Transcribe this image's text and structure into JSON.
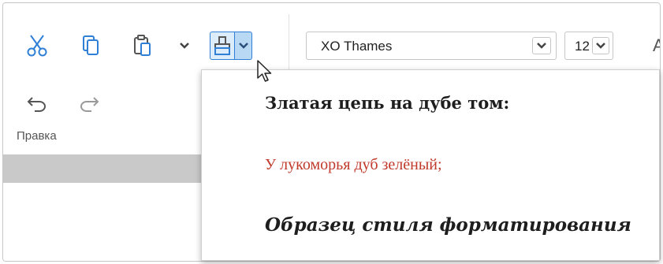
{
  "toolbar": {
    "group_label": "Правка",
    "font_name": "XO Thames",
    "font_size": "12",
    "next_button_letter": "A",
    "icons": [
      "cut-icon",
      "copy-icon",
      "paste-icon",
      "format-painter-icon",
      "undo-icon",
      "redo-icon"
    ],
    "accent_color": "#2f7fd6"
  },
  "popup": {
    "styles": [
      {
        "label": "Златая цепь на дубе том:",
        "color": "#1e1e1e"
      },
      {
        "label": "У лукоморья дуб зелёный;",
        "color": "#c0392b"
      },
      {
        "label": "Образец стиля форматирования",
        "color": "#1e1e1e"
      }
    ]
  }
}
